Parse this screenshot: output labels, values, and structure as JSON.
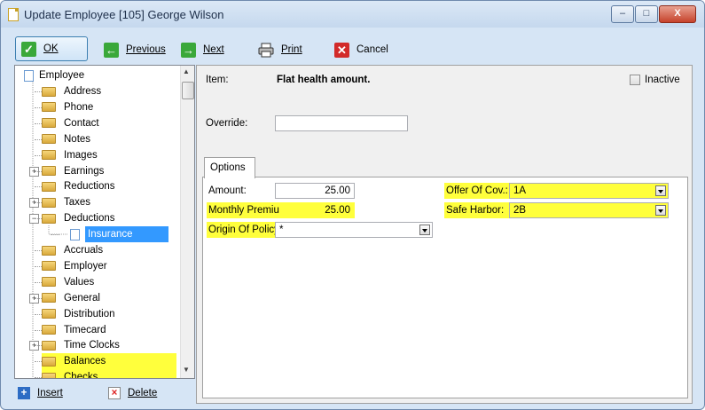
{
  "window": {
    "title": "Update Employee [105] George Wilson",
    "controls": {
      "minimize": "–",
      "maximize": "□",
      "close": "X"
    }
  },
  "toolbar": {
    "ok": "OK",
    "previous": "Previous",
    "next": "Next",
    "print": "Print",
    "cancel": "Cancel"
  },
  "tree": {
    "root": "Employee",
    "items": [
      {
        "label": "Address",
        "expander": ""
      },
      {
        "label": "Phone",
        "expander": ""
      },
      {
        "label": "Contact",
        "expander": ""
      },
      {
        "label": "Notes",
        "expander": ""
      },
      {
        "label": "Images",
        "expander": ""
      },
      {
        "label": "Earnings",
        "expander": "+"
      },
      {
        "label": "Reductions",
        "expander": ""
      },
      {
        "label": "Taxes",
        "expander": "+"
      },
      {
        "label": "Deductions",
        "expander": "−"
      },
      {
        "label": "Insurance",
        "expander": ""
      },
      {
        "label": "Accruals",
        "expander": ""
      },
      {
        "label": "Employer",
        "expander": ""
      },
      {
        "label": "Values",
        "expander": ""
      },
      {
        "label": "General",
        "expander": "+"
      },
      {
        "label": "Distribution",
        "expander": ""
      },
      {
        "label": "Timecard",
        "expander": ""
      },
      {
        "label": "Time Clocks",
        "expander": "+"
      },
      {
        "label": "Balances",
        "expander": ""
      },
      {
        "label": "Checks",
        "expander": ""
      }
    ],
    "insert": "Insert",
    "delete": "Delete"
  },
  "detail": {
    "item_label": "Item:",
    "item_value": "Flat health amount.",
    "inactive_label": "Inactive",
    "override_label": "Override:",
    "override_value": "",
    "tab_options": "Options",
    "amount_label": "Amount:",
    "amount_value": "25.00",
    "monthly_premium_label": "Monthly Premiu",
    "monthly_premium_value": "25.00",
    "origin_label": "Origin Of Policy:",
    "origin_value": "*",
    "offer_label": "Offer Of Cov.:",
    "offer_value": "1A",
    "safe_harbor_label": "Safe Harbor:",
    "safe_harbor_value": "2B"
  },
  "colors": {
    "highlight": "#ffff3c",
    "selection": "#3399ff",
    "window_bg": "#d6e5f5"
  }
}
